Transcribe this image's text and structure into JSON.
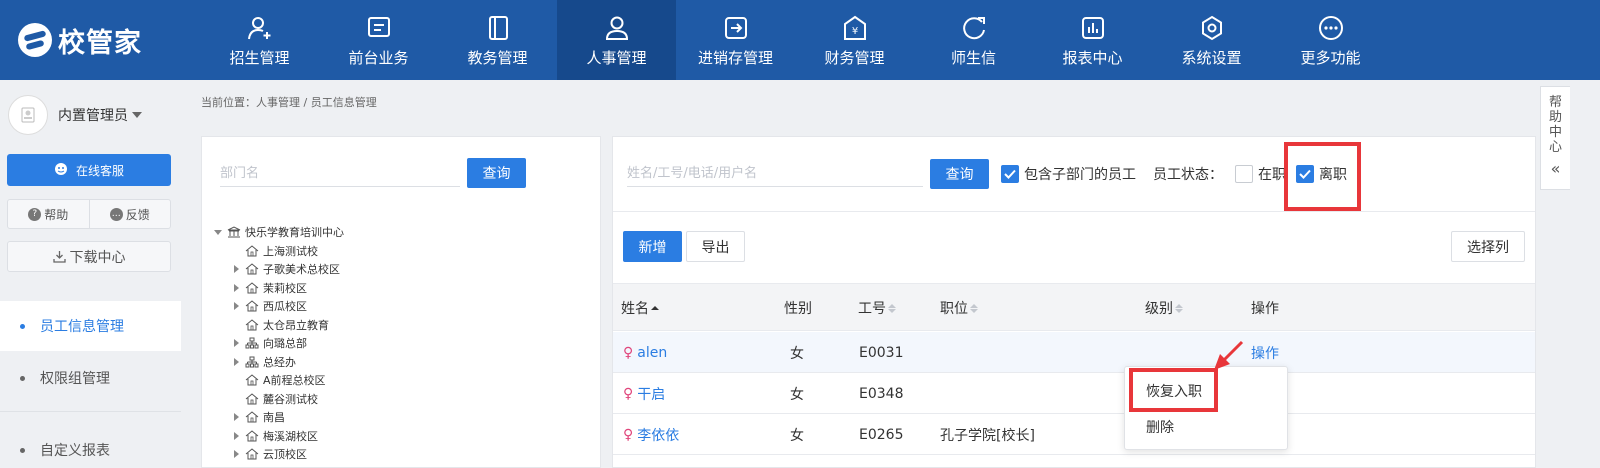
{
  "app": {
    "brand": "校管家"
  },
  "nav": {
    "items": [
      {
        "label": "招生管理",
        "icon": "user-plus-icon"
      },
      {
        "label": "前台业务",
        "icon": "desk-icon"
      },
      {
        "label": "教务管理",
        "icon": "book-icon"
      },
      {
        "label": "人事管理",
        "icon": "person-icon",
        "active": true
      },
      {
        "label": "进销存管理",
        "icon": "inventory-icon"
      },
      {
        "label": "财务管理",
        "icon": "yen-icon"
      },
      {
        "label": "师生信",
        "icon": "chat-icon"
      },
      {
        "label": "报表中心",
        "icon": "report-icon"
      },
      {
        "label": "系统设置",
        "icon": "settings-icon"
      },
      {
        "label": "更多功能",
        "icon": "more-icon"
      }
    ]
  },
  "sidebar": {
    "user_name": "内置管理员",
    "service_label": "在线客服",
    "help_label": "帮助",
    "feedback_label": "反馈",
    "download_label": "下载中心",
    "menu": [
      {
        "label": "员工信息管理",
        "active": true
      },
      {
        "label": "权限组管理"
      },
      {
        "label": "自定义报表"
      }
    ]
  },
  "breadcrumb": "当前位置：人事管理 / 员工信息管理",
  "dept": {
    "placeholder": "部门名",
    "query_label": "查询",
    "tree": [
      {
        "label": "快乐学教育培训中心",
        "level": 0,
        "expand": "open",
        "icon": "bank"
      },
      {
        "label": "上海测试校",
        "level": 1,
        "expand": "none",
        "icon": "home"
      },
      {
        "label": "子歌美术总校区",
        "level": 1,
        "expand": "closed",
        "icon": "home"
      },
      {
        "label": "茉莉校区",
        "level": 1,
        "expand": "closed",
        "icon": "home"
      },
      {
        "label": "西瓜校区",
        "level": 1,
        "expand": "closed",
        "icon": "home"
      },
      {
        "label": "太仓昂立教育",
        "level": 1,
        "expand": "none",
        "icon": "home"
      },
      {
        "label": "向璐总部",
        "level": 1,
        "expand": "closed",
        "icon": "org"
      },
      {
        "label": "总经办",
        "level": 1,
        "expand": "closed",
        "icon": "org"
      },
      {
        "label": "A前程总校区",
        "level": 1,
        "expand": "none",
        "icon": "home"
      },
      {
        "label": "麓谷测试校",
        "level": 1,
        "expand": "none",
        "icon": "home"
      },
      {
        "label": "南昌",
        "level": 1,
        "expand": "closed",
        "icon": "home"
      },
      {
        "label": "梅溪湖校区",
        "level": 1,
        "expand": "closed",
        "icon": "home"
      },
      {
        "label": "云顶校区",
        "level": 1,
        "expand": "closed",
        "icon": "home"
      }
    ]
  },
  "employees": {
    "search_placeholder": "姓名/工号/电话/用户名",
    "query_label": "查询",
    "include_sub_label": "包含子部门的员工",
    "include_sub_checked": true,
    "status_label": "员工状态：",
    "status_active_label": "在职",
    "status_active_checked": false,
    "status_left_label": "离职",
    "status_left_checked": true,
    "add_label": "新增",
    "export_label": "导出",
    "columns_label": "选择列",
    "headers": {
      "name": "姓名",
      "gender": "性别",
      "id": "工号",
      "position": "职位",
      "level": "级别",
      "action": "操作"
    },
    "rows": [
      {
        "name": "alen",
        "gender": "女",
        "id": "E0031",
        "position": "",
        "level": "",
        "action": "操作"
      },
      {
        "name": "干启",
        "gender": "女",
        "id": "E0348",
        "position": "",
        "level": "",
        "action": ""
      },
      {
        "name": "李依依",
        "gender": "女",
        "id": "E0265",
        "position": "孔子学院[校长]",
        "level": "",
        "action": ""
      }
    ],
    "popover": {
      "restore_label": "恢复入职",
      "delete_label": "删除"
    }
  },
  "help_tab": {
    "label": "帮助中心",
    "collapse": "«"
  },
  "colors": {
    "nav_bg": "#1f5aa6",
    "accent": "#2b7de2",
    "highlight": "#e8363a"
  }
}
